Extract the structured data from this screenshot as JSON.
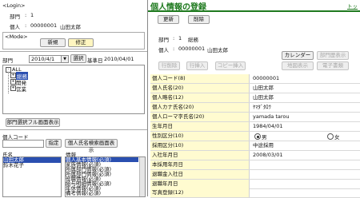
{
  "left": {
    "login_title": "<Login>",
    "login_rows": [
      {
        "label": "部門",
        "colon": ":",
        "value": "1"
      },
      {
        "label": "個人",
        "colon": ":",
        "value": "00000001",
        "name": "山田太郎"
      }
    ],
    "mode_title": "<Mode>",
    "new_button": "新規",
    "edit_button": "修正",
    "dept_label": "部門",
    "date_value": "2010/4/1",
    "select_button": "選択",
    "base_date_label": "基準日",
    "base_date_value": "2010/04/01",
    "tree": [
      {
        "label": "ALL",
        "level": 0,
        "selected": false
      },
      {
        "label": "総務",
        "level": 1,
        "selected": true
      },
      {
        "label": "開発",
        "level": 1,
        "selected": false
      },
      {
        "label": "営業",
        "level": 1,
        "selected": false
      }
    ],
    "dept_full_button": "部門選択フル画面表示",
    "personal_code_label": "個人コード",
    "designate_button": "指定",
    "name_search_button": "個人氏名検索画面表示",
    "list_headers": {
      "name": "氏名",
      "info": "情報"
    },
    "list_names": [
      "山田太郎",
      "鈴木花子"
    ],
    "list_info": [
      "個人基本情報(必須)",
      "家族情報(必須)",
      "所属部門情報(必須)",
      "所属部門情報(必須)",
      "役職情報(必須)",
      "給与明細情報(必須)",
      "年休情報(必須)",
      "備考情報(必須)"
    ]
  },
  "right": {
    "title": "個人情報の登録",
    "corner_link": "トッ",
    "update_button": "更新",
    "delete_button": "削除",
    "dept_row": {
      "label": "部門",
      "colon": ":",
      "value": "1",
      "name": "総務"
    },
    "person_row": {
      "label": "個人",
      "colon": ":",
      "value": "00000001",
      "name": "山田太郎"
    },
    "calendar_button": "カレンダー",
    "dept_history_button": "部門歴表示",
    "row_delete_button": "行削除",
    "row_insert_button": "行挿入",
    "copy_insert_button": "コピー挿入",
    "map_button": "地図表示",
    "e_doc_button": "電子書類",
    "fields": [
      {
        "label": "個人コード(8)",
        "value": "00000001"
      },
      {
        "label": "個人氏名(20)",
        "value": "山田太郎"
      },
      {
        "label": "個人略名(12)",
        "value": "山田太郎"
      },
      {
        "label": "個人カナ氏名(20)",
        "value": "ﾔﾏﾀﾞﾀﾛｳ"
      },
      {
        "label": "個人ローマ字氏名(20)",
        "value": "yamada tarou"
      },
      {
        "label": "生年月日",
        "value": "1984/04/01"
      },
      {
        "label": "性別区分(10)",
        "value": ""
      },
      {
        "label": "採用区分(10)",
        "value": "中途採用"
      },
      {
        "label": "入社年月日",
        "value": "2008/03/01"
      },
      {
        "label": "本採用年月日",
        "value": ""
      },
      {
        "label": "退職金入社日",
        "value": ""
      },
      {
        "label": "退職年月日",
        "value": ""
      },
      {
        "label": "写真登録(12)",
        "value": ""
      }
    ],
    "gender_options": [
      "男",
      "女"
    ]
  },
  "colors": {
    "title_green": "#1f7a1f",
    "selected_blue": "#2a4fb0",
    "label_yellow": "#fffbd0"
  }
}
